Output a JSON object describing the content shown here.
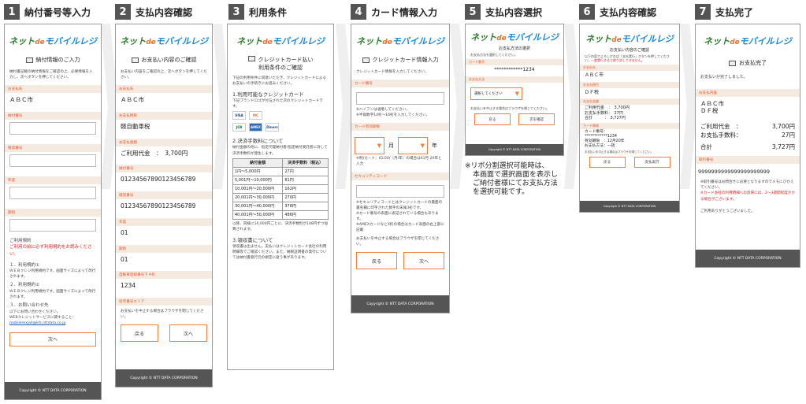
{
  "steps": [
    {
      "num": "1",
      "title": "納付番号等入力"
    },
    {
      "num": "2",
      "title": "支払内容確認"
    },
    {
      "num": "3",
      "title": "利用条件"
    },
    {
      "num": "4",
      "title": "カード情報入力"
    },
    {
      "num": "5",
      "title": "支払内容選択"
    },
    {
      "num": "6",
      "title": "支払内容確認"
    },
    {
      "num": "7",
      "title": "支払完了"
    }
  ],
  "logo": {
    "a": "ネット",
    "b": "de",
    "c": "モバイルレジ"
  },
  "copyright": "Copyright © NTT DATA CORPORATION",
  "s1": {
    "header": "納付情報のご入力",
    "intro": "納付書記載の納付情報をご確認の上、必要情報を入力し、次へボタンを押してください。",
    "label_name": "お支払先",
    "name_value": "ＡＢＣ市",
    "label_no": "納付番号",
    "label_confirm": "確認番号",
    "label_year": "年度",
    "label_period": "期別",
    "terms_title": "ご利用規約",
    "terms_note": "ご利用の前に必ず利用規約をお読みください。",
    "t1": "１．利用規約①",
    "t1d": "ＷＥＢクレジ利用規約です。画面サイズによって改行されます。",
    "t2": "２．利用規約②",
    "t2d": "ＷＥＢクレジ利用規約です。画面サイズによって改行されます。",
    "t3": "３．お問い合わせ先",
    "t3d": "以下にお問い合わせください。",
    "t3e": "WEBクレジットサービスに関すること：",
    "email": "mobilerexjail@kfs.nttdata.co.jp",
    "next": "次へ"
  },
  "s2": {
    "header": "お支払い内容のご確認",
    "intro": "お支払い内容をご確認の上、次へボタンを押してください。",
    "l_pay": "お支払先",
    "v_pay": "ＡＢＣ市",
    "l_tax": "お支払税目",
    "v_tax": "軽自動車税",
    "l_amt": "お支払金額",
    "v_amt": "ご利用代金　：　3,700円",
    "l_no": "納付番号",
    "v_no": "01234567890123456789",
    "l_conf": "確認番号",
    "v_conf": "01234567890123456789",
    "l_year": "年度",
    "v_year": "01",
    "l_per": "期別",
    "v_per": "01",
    "l_code": "自動車登録番号下４桁",
    "v_code": "1234",
    "l_area": "住宅番号エリア",
    "note": "お支払いを中止する場合はブラウザを閉じてください。",
    "back": "戻る",
    "next": "次へ"
  },
  "s3": {
    "header1": "クレジットカード払い",
    "header2": "利用条件のご確認",
    "intro": "下記の利用条件に同意いただき、クレジットカードによるお支払いの手続きにお進みください。",
    "sec1": "1.利用可能なクレジットカード",
    "sec1d": "下記ブランドロゴが付与された次のクレジットカードです。",
    "cards": [
      "VISA",
      "MC",
      "JCB",
      "AMEX",
      "Diners"
    ],
    "sec2": "2.決済手数料について",
    "sec2d": "納付金額の他に、指定代理納付者/指定納付受託者に対して決済手数料が発生します。",
    "th1": "納付金額",
    "th2": "決済手数料（税込）",
    "rows": [
      [
        "1円～5,000円",
        "27円"
      ],
      [
        "5,001円～10,000円",
        "81円"
      ],
      [
        "10,001円～20,000円",
        "162円"
      ],
      [
        "20,001円～30,000円",
        "270円"
      ],
      [
        "30,001円～40,000円",
        "378円"
      ],
      [
        "40,001円～50,000円",
        "486円"
      ]
    ],
    "after": "以降、同様に10,000円ごとに、決済手数料が108円ずつ加算されます。",
    "sec3": "3.領収書について",
    "sec3d": "領収書は出ません。支払いはクレジットカード会社の利用明細等でご確認ください。また、納税証明書の発行については納付書発行元の規定に従う事があります。"
  },
  "s4": {
    "header": "クレジットカード情報入力",
    "intro": "クレジットカード情報を入力してください。",
    "l_no": "カード番号",
    "hint1": "※ハイフンは省略してください。",
    "hint2": "※半角数字14桁～16桁を入力してください。",
    "l_exp": "カード有効期限",
    "month": "月",
    "year": "年",
    "exp_hint": "※例)カード：01/20/（月/年）の場合は01月 20年と入力",
    "l_sec": "セキュリティコード",
    "sec_hint1": "※セキュリティコードとはクレジットカードの裏面の署名欄に印字された数字の末尾3桁です。",
    "sec_hint2": "※カード番号の表面に表記されている場合もあります。",
    "sec_hint3": "※AMEXカードなど4桁の場合はカード表面の右上部に記載",
    "note": "お支払いを中止する場合はブラウザを閉じてください。",
    "back": "戻る",
    "next": "次へ"
  },
  "s5": {
    "header": "お支払方法の選択",
    "intro": "お支払方法を選択してください。",
    "l_card": "カード番号",
    "v_card": "************1234",
    "l_method": "お支払方法",
    "sel": "選択してください",
    "note": "お支払いを中止する場合はブラウザを閉じてください。",
    "back": "戻る",
    "next": "次を確認"
  },
  "s6": {
    "header": "お支払い内容のご確認",
    "intro": "以下内容でよろしければ「支払実行」ボタンを押してください。",
    "intro_red": "一度実行すると取り消しできません。",
    "l_pay": "お支払先",
    "v_pay": "ＡＢＣ市",
    "l_tax": "お支払税目",
    "v_tax": "ＤＦ税",
    "l_amt": "お支払金額",
    "v_use": "ご利用代金　：　3,700円",
    "v_fee": "お支払手数料：　27円",
    "v_total": "合計　　　：　3,727円",
    "l_card": "カード情報",
    "v_c1": "カード番号：",
    "v_c2": "************1234",
    "v_c3": "有効期限　：12月20年",
    "v_c4": "お支払方法：一括",
    "note": "お支払いを中止する場合はブラウザを閉じてください。",
    "back": "戻る",
    "next": "支払実行"
  },
  "s7": {
    "header": "お支払完了",
    "intro": "お支払いが完了しました。",
    "l_pay": "お支払内容",
    "v_pay1": "ＡＢＣ市",
    "v_pay2": "ＤＦ税",
    "use_l": "ご利用代金　：",
    "use_v": "3,700円",
    "fee_l": "お支払手数料：",
    "fee_v": "27円",
    "tot_l": "合計",
    "tot_v": "3,727円",
    "l_rcpt": "取引番号",
    "v_rcpt": "9999999999999999999999",
    "n1": "※取引番号はお問合せに必要となりますのでメモにひかえてください。",
    "n2": "※カード会社の利用明細への反映には、2～3週間程度かかる場合がございます。",
    "thanks": "ご利用ありがとうございました。"
  },
  "note5": [
    "※リボ分割選択可能時は、",
    "本画面で選択画面を表示し",
    "ご納付者様にてお支払方法",
    "を選択可能です。"
  ]
}
